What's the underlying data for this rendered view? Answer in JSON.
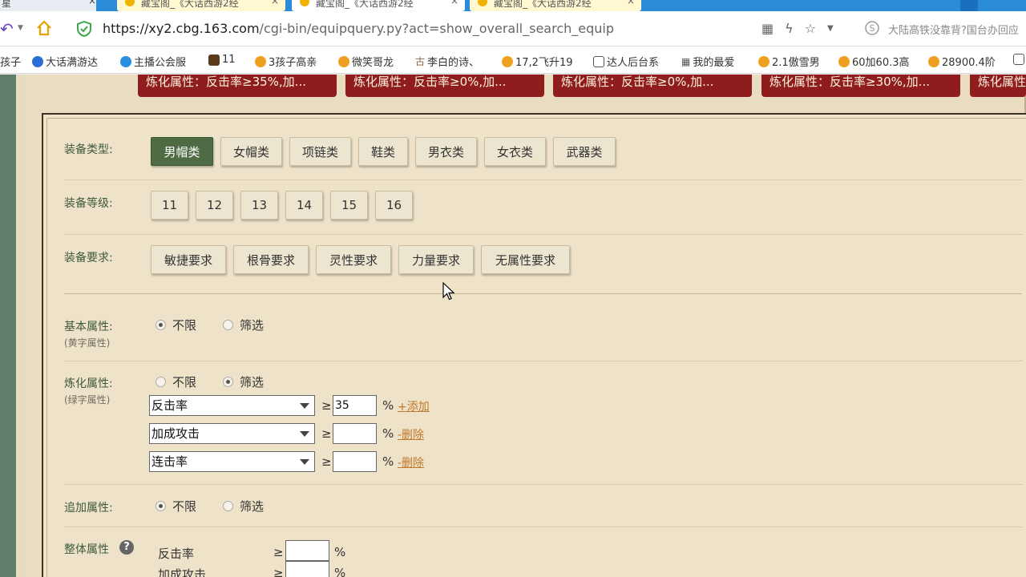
{
  "browser": {
    "tabs": [
      {
        "label": "藏宝阁_《大话西游2经"
      },
      {
        "label": "藏宝阁_《大话西游2经"
      },
      {
        "label": "藏宝阁_《大话西游2经"
      }
    ],
    "left_tab_fragment": "星",
    "url_host": "https://xy2.cbg.163.com",
    "url_path": "/cgi-bin/equipquery.py?act=show_overall_search_equip",
    "search_hint": "大陆高铁没靠背?国台办回应"
  },
  "bookmarks": [
    {
      "label": "孩子",
      "color": "#ffffff"
    },
    {
      "label": "大话满游达",
      "color": "#2b6fd6"
    },
    {
      "label": "主播公会服",
      "color": "#2a8fe0"
    },
    {
      "label": "11",
      "color": "#5a3a1a"
    },
    {
      "label": "3孩子高亲",
      "color": "#f0a020"
    },
    {
      "label": "微笑哥龙",
      "color": "#f0a020"
    },
    {
      "label": "李白的诗、",
      "color": "#886644"
    },
    {
      "label": "17,2飞升19",
      "color": "#f0a020"
    },
    {
      "label": "达人后台系",
      "color": "#555555"
    },
    {
      "label": "我的最爱",
      "color": "#555555"
    },
    {
      "label": "2.1傲雪男",
      "color": "#f0a020"
    },
    {
      "label": "60加60.3高",
      "color": "#f0a020"
    },
    {
      "label": "28900.4阶",
      "color": "#f0a020"
    }
  ],
  "tags": [
    "炼化属性：反击率≥35%,加...",
    "炼化属性：反击率≥0%,加...",
    "炼化属性：反击率≥0%,加...",
    "炼化属性：反击率≥30%,加...",
    "炼化属性"
  ],
  "equip_type": {
    "label": "装备类型:",
    "options": [
      "男帽类",
      "女帽类",
      "项链类",
      "鞋类",
      "男衣类",
      "女衣类",
      "武器类"
    ],
    "selected": "男帽类"
  },
  "equip_level": {
    "label": "装备等级:",
    "options": [
      "11",
      "12",
      "13",
      "14",
      "15",
      "16"
    ]
  },
  "equip_req": {
    "label": "装备要求:",
    "options": [
      "敏捷要求",
      "根骨要求",
      "灵性要求",
      "力量要求",
      "无属性要求"
    ]
  },
  "basic_attr": {
    "label": "基本属性:",
    "sublabel": "(黄字属性)",
    "opt_any": "不限",
    "opt_filter": "筛选",
    "selected": "不限"
  },
  "refine_attr": {
    "label": "炼化属性:",
    "sublabel": "(绿字属性)",
    "opt_any": "不限",
    "opt_filter": "筛选",
    "selected": "筛选",
    "ge": "≥",
    "pct": "%",
    "rows": [
      {
        "select": "反击率",
        "value": "35",
        "action": "+添加"
      },
      {
        "select": "加成攻击",
        "value": "",
        "action": "-删除"
      },
      {
        "select": "连击率",
        "value": "",
        "action": "-删除"
      }
    ]
  },
  "extra_attr": {
    "label": "追加属性:",
    "opt_any": "不限",
    "opt_filter": "筛选",
    "selected": "不限"
  },
  "overall_attr": {
    "label": "整体属性",
    "help": "?",
    "ge": "≥",
    "pct": "%",
    "rows": [
      {
        "name": "反击率",
        "value": ""
      },
      {
        "name": "加成攻击",
        "value": ""
      }
    ]
  }
}
